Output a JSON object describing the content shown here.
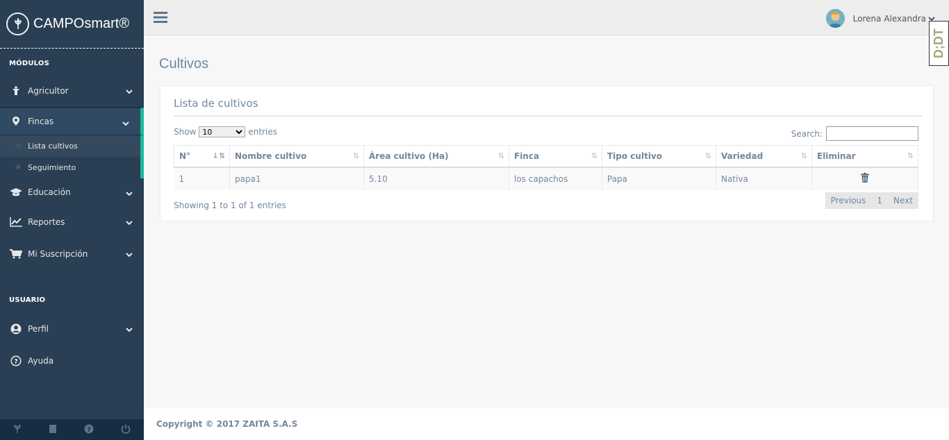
{
  "brand": {
    "title": "CAMPOsmart®"
  },
  "sidebar": {
    "section_modules": "MÓDULOS",
    "section_user": "USUARIO",
    "items": [
      {
        "label": "Agricultor",
        "icon": "farmer-icon"
      },
      {
        "label": "Fincas",
        "icon": "map-marker-icon"
      },
      {
        "label": "Educación",
        "icon": "graduation-cap-icon"
      },
      {
        "label": "Reportes",
        "icon": "line-chart-icon"
      },
      {
        "label": "Mi Suscripción",
        "icon": "shopping-cart-icon"
      }
    ],
    "submenu": [
      {
        "label": "Lista cultivos"
      },
      {
        "label": "Seguimiento"
      }
    ],
    "user_items": [
      {
        "label": "Perfil",
        "icon": "user-circle-icon"
      },
      {
        "label": "Ayuda",
        "icon": "question-circle-icon"
      }
    ]
  },
  "topnav": {
    "user_name": "Lorena Alexandra",
    "badge": "D;DT"
  },
  "page": {
    "title": "Cultivos"
  },
  "panel": {
    "title": "Lista de cultivos",
    "show_label": "Show",
    "entries_label": "entries",
    "entries_value": "10",
    "search_label": "Search:",
    "columns": [
      "N°",
      "Nombre cultivo",
      "Área cultivo (Ha)",
      "Finca",
      "Tipo cultivo",
      "Variedad",
      "Eliminar"
    ],
    "rows": [
      [
        "1",
        "papa1",
        "5.10",
        "los capachos",
        "Papa",
        "Nativa"
      ]
    ],
    "info": "Showing 1 to 1 of 1 entries",
    "pagination": {
      "previous": "Previous",
      "page": "1",
      "next": "Next"
    }
  },
  "footer": {
    "text": "Copyright © 2017 ZAITA S.A.S"
  }
}
